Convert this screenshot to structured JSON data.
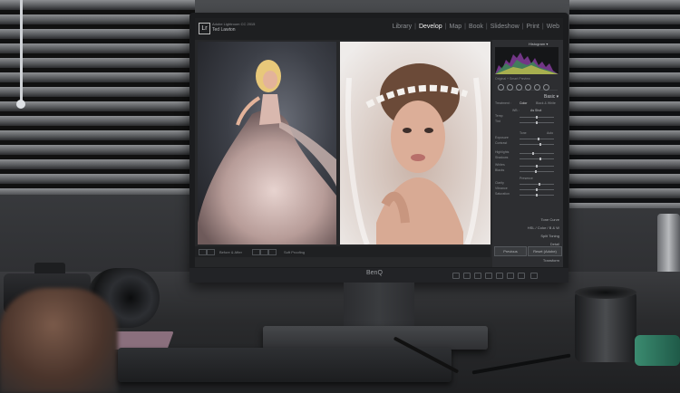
{
  "monitor": {
    "brand": "BenQ"
  },
  "lightroom": {
    "logo": "Lr",
    "identity_line1": "Adobe Lightroom CC 2015",
    "identity_line2": "Ted Lawton",
    "modules": [
      "Library",
      "Develop",
      "Map",
      "Book",
      "Slideshow",
      "Print",
      "Web"
    ],
    "active_module": "Develop",
    "toolbar": {
      "view_mode": "Before & After",
      "soft_proofing": "Soft Proofing"
    },
    "panel": {
      "histogram_label": "Histogram ▾",
      "photo_info": "Original + Smart Preview",
      "basic_label": "Basic ▾",
      "treatment_label": "Treatment :",
      "treatment_options": [
        "Color",
        "Black & White"
      ],
      "wb_label": "WB :",
      "wb_value": "As Shot",
      "tone_label": "Tone",
      "tone_auto": "Auto",
      "presence_label": "Presence",
      "sliders": [
        {
          "label": "Temp",
          "value": 0.5
        },
        {
          "label": "Tint",
          "value": 0.5
        },
        {
          "label": "Exposure",
          "value": 0.55
        },
        {
          "label": "Contrast",
          "value": 0.6
        },
        {
          "label": "Highlights",
          "value": 0.4
        },
        {
          "label": "Shadows",
          "value": 0.62
        },
        {
          "label": "Whites",
          "value": 0.5
        },
        {
          "label": "Blacks",
          "value": 0.48
        },
        {
          "label": "Clarity",
          "value": 0.58
        },
        {
          "label": "Vibrance",
          "value": 0.5
        },
        {
          "label": "Saturation",
          "value": 0.5
        }
      ],
      "sections": [
        "Tone Curve",
        "HSL / Color / B & W",
        "Split Toning",
        "Detail",
        "Lens Corrections",
        "Transform"
      ],
      "previous_button": "Previous",
      "reset_button": "Reset (Adobe)"
    }
  },
  "colors": {
    "active_module": "#f2f2f2",
    "panel_bg": "#2d2e31",
    "canister": "#3b8b70"
  },
  "icons": [
    "camera-icon",
    "histogram-icon",
    "crop-tool-icon",
    "spot-removal-icon",
    "red-eye-icon",
    "graduated-filter-icon",
    "radial-filter-icon",
    "adjustment-brush-icon"
  ]
}
